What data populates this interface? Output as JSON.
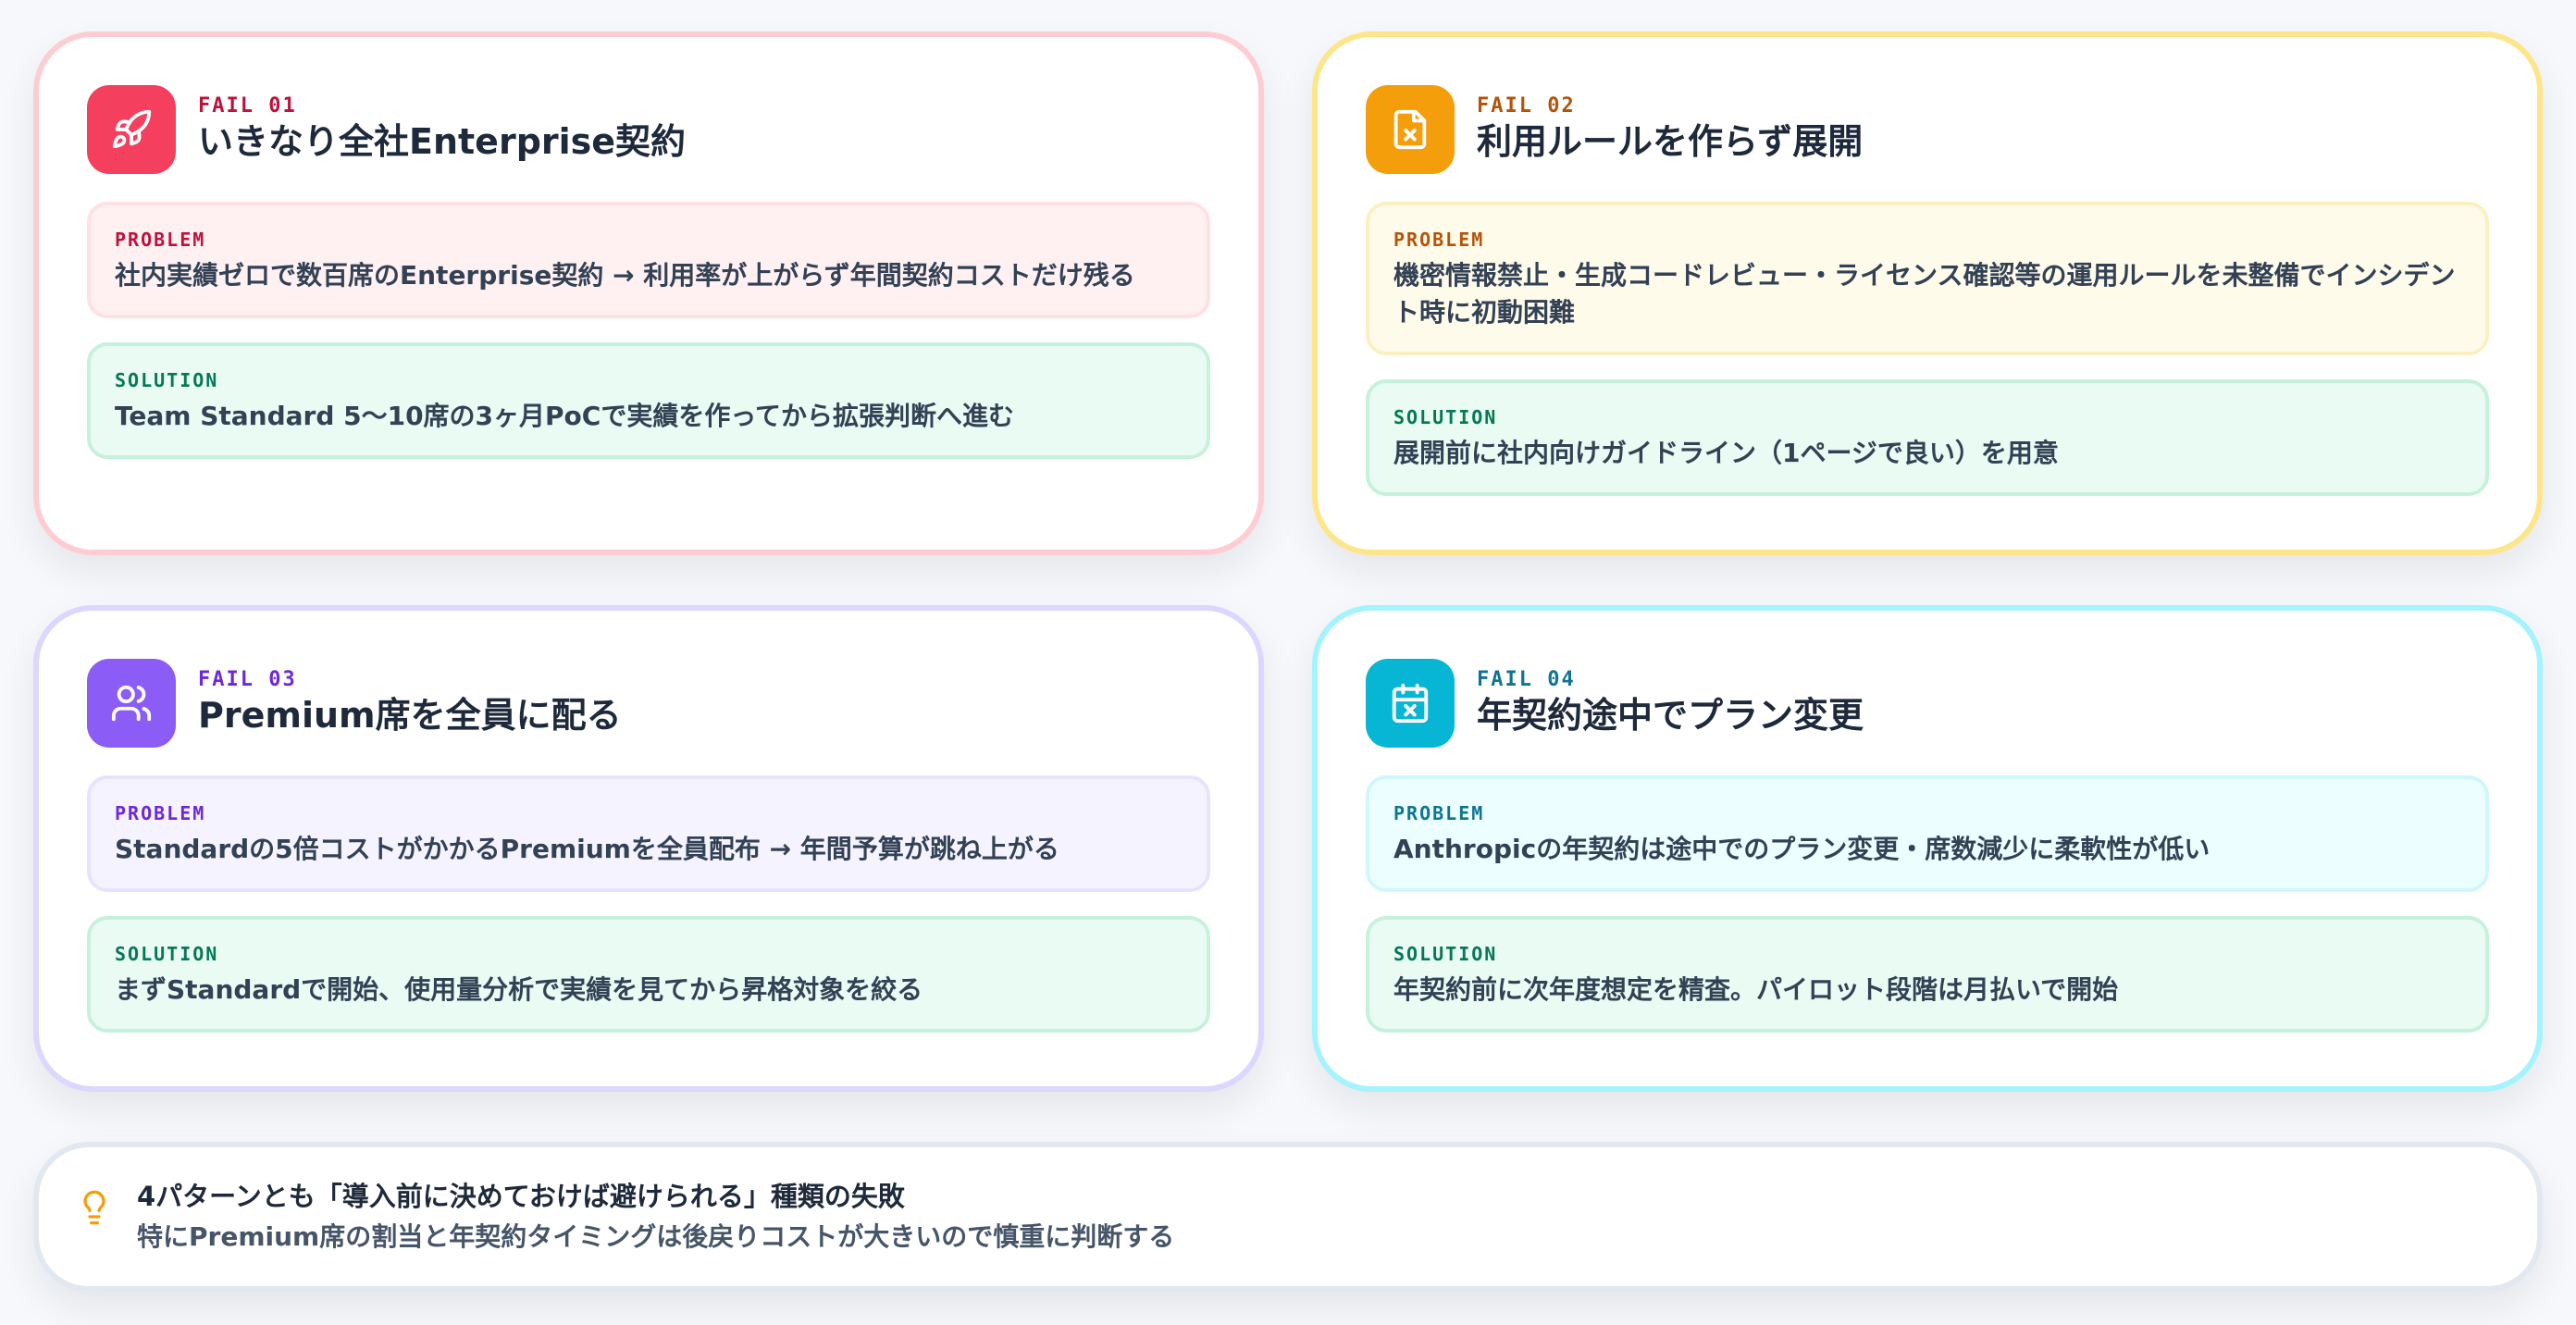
{
  "cards": [
    {
      "label": "FAIL 01",
      "title": "いきなり全社Enterprise契約",
      "icon": "rocket-icon",
      "accent": "#f43f5e",
      "problem_label": "PROBLEM",
      "problem": "社内実績ゼロで数百席のEnterprise契約 → 利用率が上がらず年間契約コストだけ残る",
      "solution_label": "SOLUTION",
      "solution": "Team Standard 5〜10席の3ヶ月PoCで実績を作ってから拡張判断へ進む"
    },
    {
      "label": "FAIL 02",
      "title": "利用ルールを作らず展開",
      "icon": "file-x-icon",
      "accent": "#f59e0b",
      "problem_label": "PROBLEM",
      "problem": "機密情報禁止・生成コードレビュー・ライセンス確認等の運用ルールを未整備でインシデント時に初動困難",
      "solution_label": "SOLUTION",
      "solution": "展開前に社内向けガイドライン（1ページで良い）を用意"
    },
    {
      "label": "FAIL 03",
      "title": "Premium席を全員に配る",
      "icon": "users-icon",
      "accent": "#8b5cf6",
      "problem_label": "PROBLEM",
      "problem": "Standardの5倍コストがかかるPremiumを全員配布 → 年間予算が跳ね上がる",
      "solution_label": "SOLUTION",
      "solution": "まずStandardで開始、使用量分析で実績を見てから昇格対象を絞る"
    },
    {
      "label": "FAIL 04",
      "title": "年契約途中でプラン変更",
      "icon": "calendar-x-icon",
      "accent": "#06b6d4",
      "problem_label": "PROBLEM",
      "problem": "Anthropicの年契約は途中でのプラン変更・席数減少に柔軟性が低い",
      "solution_label": "SOLUTION",
      "solution": "年契約前に次年度想定を精査。パイロット段階は月払いで開始"
    }
  ],
  "note": {
    "icon": "lightbulb-icon",
    "title": "4パターンとも「導入前に決めておけば避けられる」種類の失敗",
    "subtitle": "特にPremium席の割当と年契約タイミングは後戻りコストが大きいので慎重に判断する"
  }
}
